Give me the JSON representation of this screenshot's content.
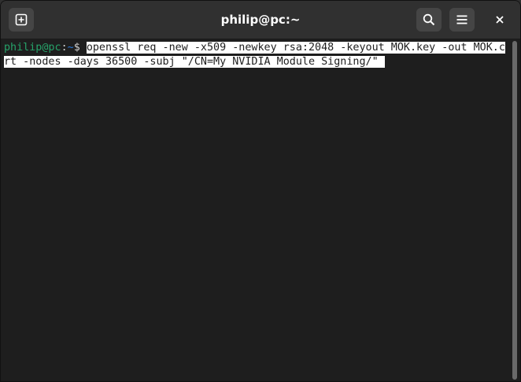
{
  "window": {
    "title": "philip@pc:~"
  },
  "icons": {
    "new_tab": "new-tab-icon",
    "search": "search-icon",
    "menu": "hamburger-menu-icon",
    "close": "close-icon"
  },
  "terminal": {
    "prompt_user": "philip@pc",
    "prompt_sep": ":",
    "prompt_path": "~",
    "prompt_symbol": "$ ",
    "command": "openssl req -new -x509 -newkey rsa:2048 -keyout MOK.key -out MOK.crt -nodes -days 36500 -subj \"/CN=My NVIDIA Module Signing/\" "
  },
  "colors": {
    "background": "#1e1e1e",
    "titlebar": "#303030",
    "prompt_user": "#26a269",
    "prompt_path": "#2a7bde",
    "selection": "#ffffff"
  }
}
